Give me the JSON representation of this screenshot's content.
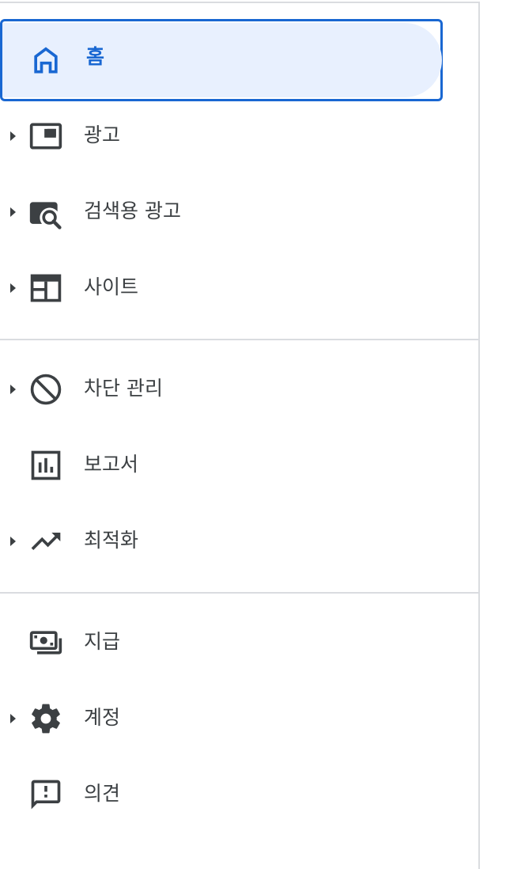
{
  "nav": {
    "items": [
      {
        "label": "홈",
        "icon": "home-icon",
        "selected": true,
        "expandable": false
      },
      {
        "label": "광고",
        "icon": "ads-icon",
        "selected": false,
        "expandable": true
      },
      {
        "label": "검색용 광고",
        "icon": "search-ads-icon",
        "selected": false,
        "expandable": true
      },
      {
        "label": "사이트",
        "icon": "sites-icon",
        "selected": false,
        "expandable": true
      },
      {
        "label": "차단 관리",
        "icon": "block-icon",
        "selected": false,
        "expandable": true
      },
      {
        "label": "보고서",
        "icon": "reports-icon",
        "selected": false,
        "expandable": false
      },
      {
        "label": "최적화",
        "icon": "trending-up-icon",
        "selected": false,
        "expandable": true
      },
      {
        "label": "지급",
        "icon": "payments-icon",
        "selected": false,
        "expandable": false
      },
      {
        "label": "계정",
        "icon": "gear-icon",
        "selected": false,
        "expandable": true
      },
      {
        "label": "의견",
        "icon": "feedback-icon",
        "selected": false,
        "expandable": false
      }
    ]
  },
  "colors": {
    "accent": "#1967d2",
    "selected_bg": "#e8f0fe",
    "text": "#3c4043",
    "divider": "#dadce0"
  }
}
